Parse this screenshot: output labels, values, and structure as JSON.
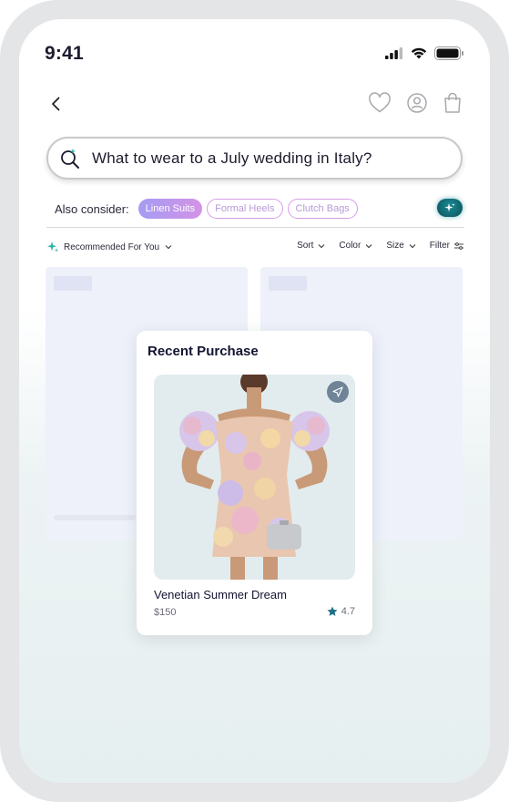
{
  "status_bar": {
    "time": "9:41"
  },
  "nav": {
    "back_icon": "chevron-left-icon",
    "icons": [
      "heart-icon",
      "user-icon",
      "bag-icon"
    ]
  },
  "search": {
    "icon": "sparkle-search-icon",
    "query": "What to wear to a July wedding in Italy?"
  },
  "also_consider": {
    "label": "Also consider:",
    "chips": [
      "Linen Suits",
      "Formal Heels",
      "Clutch Bags"
    ]
  },
  "filters": {
    "recommended_label": "Recommended For You",
    "options": [
      "Sort",
      "Color",
      "Size",
      "Filter"
    ]
  },
  "recent_purchase": {
    "title": "Recent Purchase",
    "product_name": "Venetian Summer Dream",
    "price": "$150",
    "rating": "4.7"
  },
  "colors": {
    "accent_teal": "#0b5f6b",
    "chip_gradient_start": "#a59bf3",
    "chip_gradient_end": "#d393e6",
    "star": "#1f6f86"
  }
}
